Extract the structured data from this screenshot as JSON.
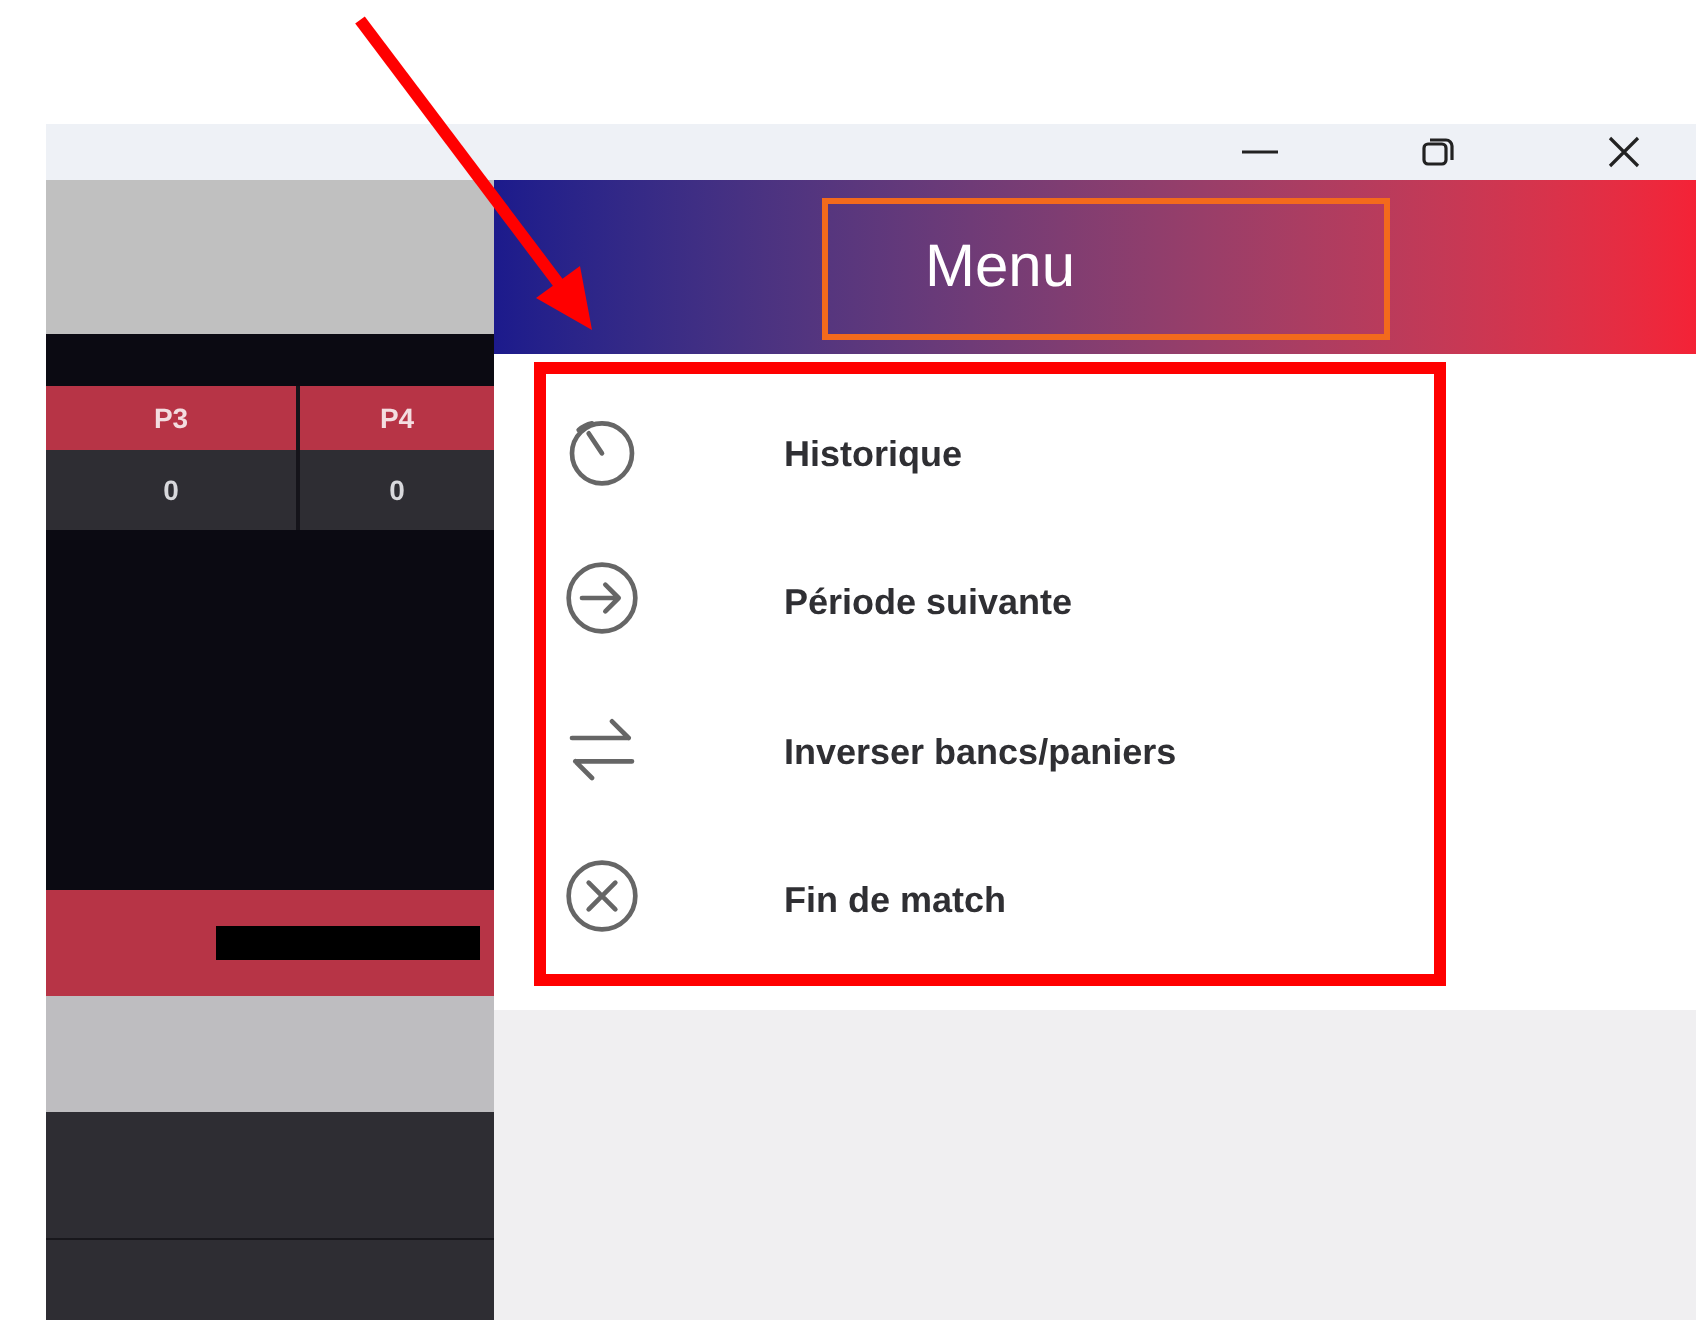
{
  "scoreboard": {
    "columns": [
      {
        "label": "P3",
        "value": "0"
      },
      {
        "label": "P4",
        "value": "0"
      }
    ]
  },
  "menu": {
    "title": "Menu",
    "items": [
      {
        "kind": "timer",
        "label": "Historique"
      },
      {
        "kind": "arrow",
        "label": "Période suivante"
      },
      {
        "kind": "swap",
        "label": "Inverser bancs/paniers"
      },
      {
        "kind": "close",
        "label": "Fin de match"
      }
    ]
  }
}
